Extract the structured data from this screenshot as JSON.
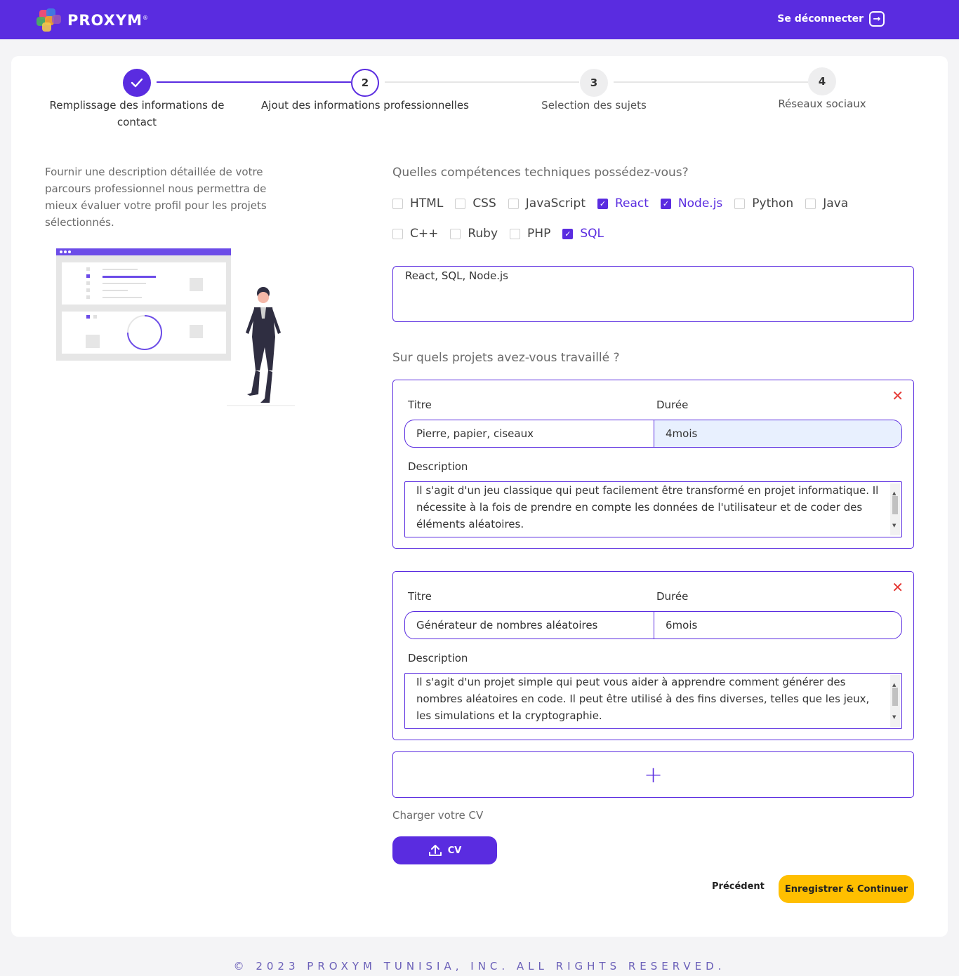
{
  "header": {
    "brand": "PROXYM",
    "brand_mark": "®",
    "logout_label": "Se déconnecter",
    "logout_icon": "logout-icon"
  },
  "stepper": {
    "steps": [
      {
        "number": "",
        "label": "Remplissage des informations de contact",
        "state": "done"
      },
      {
        "number": "2",
        "label": "Ajout des informations professionnelles",
        "state": "active"
      },
      {
        "number": "3",
        "label": "Selection des sujets",
        "state": "pending"
      },
      {
        "number": "4",
        "label": "Réseaux sociaux",
        "state": "pending"
      }
    ]
  },
  "intro": {
    "text": "Fournir une description détaillée de votre parcours professionnel nous permettra de mieux évaluer votre profil pour les projets sélectionnés."
  },
  "skills": {
    "question": "Quelles compétences techniques possédez-vous?",
    "rows": [
      [
        {
          "label": "HTML",
          "checked": false
        },
        {
          "label": "CSS",
          "checked": false
        },
        {
          "label": "JavaScript",
          "checked": false
        },
        {
          "label": "React",
          "checked": true
        },
        {
          "label": "Node.js",
          "checked": true
        },
        {
          "label": "Python",
          "checked": false
        },
        {
          "label": "Java",
          "checked": false
        }
      ],
      [
        {
          "label": "C++",
          "checked": false
        },
        {
          "label": "Ruby",
          "checked": false
        },
        {
          "label": "PHP",
          "checked": false
        },
        {
          "label": "SQL",
          "checked": true
        }
      ]
    ],
    "summary": "React, SQL, Node.js"
  },
  "projects": {
    "question": "Sur quels projets avez-vous travaillé ?",
    "title_label": "Titre",
    "duration_label": "Durée",
    "description_label": "Description",
    "items": [
      {
        "title": "Pierre, papier, ciseaux",
        "duration": "4mois",
        "description": "Il s'agit d'un jeu classique qui peut facilement être transformé en projet informatique. Il nécessite à la fois de prendre en compte les données de l'utilisateur et de coder des éléments aléatoires."
      },
      {
        "title": "Générateur de nombres aléatoires",
        "duration": "6mois",
        "description": "Il s'agit d'un projet simple qui peut vous aider à apprendre comment générer des nombres aléatoires en code. Il peut être utilisé à des fins diverses, telles que les jeux, les simulations et la cryptographie."
      }
    ],
    "add_symbol": "+"
  },
  "cv": {
    "label": "Charger votre CV",
    "button_label": "CV"
  },
  "actions": {
    "previous": "Précédent",
    "save": "Enregistrer & Continuer"
  },
  "footer": {
    "text": "© 2023 PROXYM TUNISIA, INC. ALL RIGHTS RESERVED."
  },
  "colors": {
    "primary": "#5a2ce0",
    "accent": "#ffbf00",
    "danger": "#e53935"
  }
}
